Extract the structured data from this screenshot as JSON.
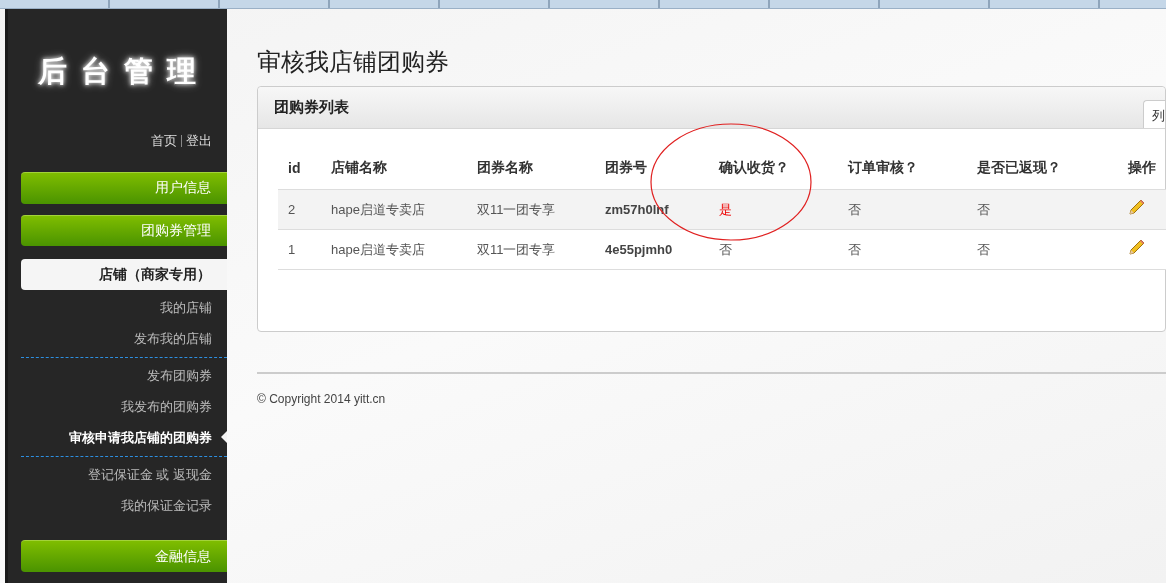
{
  "sidebar": {
    "title": "后台管理",
    "links": [
      "首页",
      "登出"
    ],
    "menu": [
      {
        "kind": "group",
        "label": "用户信息"
      },
      {
        "kind": "group",
        "label": "团购券管理"
      },
      {
        "kind": "section",
        "label": "店铺（商家专用）",
        "expanded": true,
        "groups": [
          {
            "items": [
              {
                "label": "我的店铺",
                "selected": false
              },
              {
                "label": "发布我的店铺",
                "selected": false
              }
            ]
          },
          {
            "items": [
              {
                "label": "发布团购券",
                "selected": false
              },
              {
                "label": "我发布的团购券",
                "selected": false
              },
              {
                "label": "审核申请我店铺的团购券",
                "selected": true
              }
            ]
          },
          {
            "items": [
              {
                "label": "登记保证金 或 返现金",
                "selected": false
              },
              {
                "label": "我的保证金记录",
                "selected": false
              }
            ]
          }
        ]
      },
      {
        "kind": "group",
        "label": "金融信息"
      }
    ]
  },
  "page": {
    "title": "审核我店铺团购券"
  },
  "panel": {
    "title": "团购券列表",
    "tab": "列",
    "columns": [
      "id",
      "店铺名称",
      "团券名称",
      "团券号",
      "确认收货？",
      "订单审核？",
      "是否已返现？",
      "操作"
    ],
    "rows": [
      {
        "selected": true,
        "id": "2",
        "shop": "hape启道专卖店",
        "coupon": "双11一团专享",
        "code": "zm57h0lnf",
        "received": {
          "text": "是",
          "highlight": true
        },
        "reviewed": "否",
        "cashback": "否"
      },
      {
        "selected": false,
        "id": "1",
        "shop": "hape启道专卖店",
        "coupon": "双11一团专享",
        "code": "4e55pjmh0",
        "received": {
          "text": "否",
          "highlight": false
        },
        "reviewed": "否",
        "cashback": "否"
      }
    ]
  },
  "footer": {
    "copyright": "© Copyright 2014 yitt.cn"
  }
}
